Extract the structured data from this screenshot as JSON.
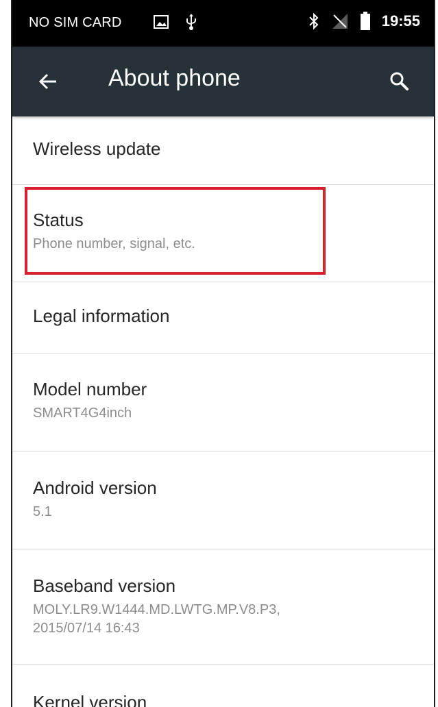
{
  "status_bar": {
    "carrier": "NO SIM CARD",
    "time": "19:55",
    "left_icons": [
      "image-icon",
      "usb-icon"
    ],
    "right_icons": [
      "bluetooth-icon",
      "no-signal-icon",
      "battery-icon"
    ]
  },
  "app_bar": {
    "title": "About phone",
    "back_icon": "back-arrow-icon",
    "search_icon": "search-icon",
    "background_color": "#263238"
  },
  "settings": [
    {
      "title": "Wireless update"
    },
    {
      "title": "Status",
      "summary": "Phone number, signal, etc."
    },
    {
      "title": "Legal information"
    },
    {
      "title": "Model number",
      "summary": "SMART4G4inch"
    },
    {
      "title": "Android version",
      "summary": "5.1"
    },
    {
      "title": "Baseband version",
      "summary": "MOLY.LR9.W1444.MD.LWTG.MP.V8.P3,\n2015/07/14 16:43"
    },
    {
      "title": "Kernel version"
    }
  ],
  "highlight": {
    "target": "Status",
    "color": "#d6202b"
  }
}
